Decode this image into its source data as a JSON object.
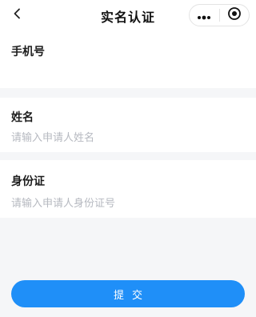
{
  "navbar": {
    "title": "实名认证",
    "back_icon": "chevron-left-icon",
    "more_icon": "more-dots-icon",
    "close_icon": "target-circle-icon"
  },
  "form": {
    "phone": {
      "label": "手机号",
      "value": "",
      "placeholder": ""
    },
    "name": {
      "label": "姓名",
      "value": "",
      "placeholder": "请输入申请人姓名"
    },
    "id_number": {
      "label": "身份证",
      "value": "",
      "placeholder": "请输入申请人身份证号"
    }
  },
  "submit": {
    "label": "提交"
  },
  "colors": {
    "accent": "#1f8ff8",
    "background": "#f5f6f8",
    "placeholder": "#b6b9c0"
  }
}
